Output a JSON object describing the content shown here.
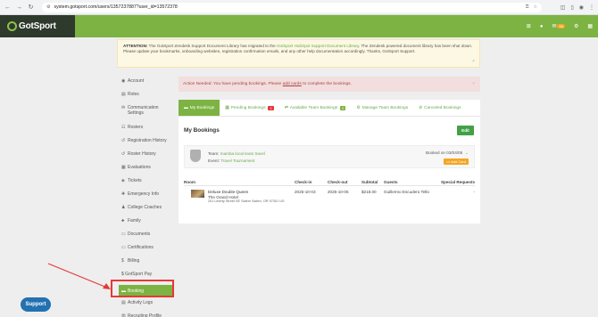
{
  "browser": {
    "url": "system.gotsport.com/users/1357237887?user_id=13572378",
    "back_label": "←",
    "forward_label": "→",
    "reload_label": "↻",
    "icons": [
      "key-icon",
      "star-icon",
      "extensions-icon",
      "profile-icon",
      "menu-icon"
    ]
  },
  "header": {
    "brand": "GotSport",
    "message_count": "99",
    "accent_color": "#7cb342"
  },
  "attention": {
    "label": "ATTENTION:",
    "text_before": " The GotSport Zendesk Support Document Library has migrated to the ",
    "link": "GotSport HubSpot Support Document Library",
    "text_after": ". The Zendesk powered document library has been shut down. Please update your bookmarks, onboarding websites, registration confirmation emails, and any other help documentation accordingly. Thanks, GotSport Support.",
    "close": "×"
  },
  "action_alert": {
    "text_before": "Action Needed: You have pending bookings. Please",
    "link": "add cards",
    "text_after": "to complete the bookings.",
    "close": "×"
  },
  "sidebar": {
    "items": [
      {
        "label": "Account",
        "icon": "user-icon",
        "glyph": "◉"
      },
      {
        "label": "Roles",
        "icon": "id-card-icon",
        "glyph": "▤"
      },
      {
        "label": "Communication Settings",
        "icon": "envelope-icon",
        "glyph": "✉"
      },
      {
        "label": "Rosters",
        "icon": "users-icon",
        "glyph": "☷"
      },
      {
        "label": "Registration History",
        "icon": "history-icon",
        "glyph": "↺"
      },
      {
        "label": "Roster History",
        "icon": "history-icon",
        "glyph": "↺"
      },
      {
        "label": "Evaluations",
        "icon": "clipboard-icon",
        "glyph": "▦"
      },
      {
        "label": "Tickets",
        "icon": "ticket-icon",
        "glyph": "◈"
      },
      {
        "label": "Emergency Info",
        "icon": "medkit-icon",
        "glyph": "✚"
      },
      {
        "label": "College Coaches",
        "icon": "graduation-icon",
        "glyph": "♟"
      },
      {
        "label": "Family",
        "icon": "family-icon",
        "glyph": "♣"
      },
      {
        "label": "Documents",
        "icon": "folder-icon",
        "glyph": "▭"
      },
      {
        "label": "Certifications",
        "icon": "folder-icon",
        "glyph": "▭"
      },
      {
        "label": "Billing",
        "icon": "dollar-icon",
        "glyph": "$"
      },
      {
        "label": "$ GotSport Pay",
        "icon": "",
        "glyph": ""
      },
      {
        "label": "Booking",
        "icon": "bed-icon",
        "glyph": "▬",
        "active": true
      },
      {
        "label": "Activity Logs",
        "icon": "list-icon",
        "glyph": "▤"
      },
      {
        "label": "Recruiting Profile",
        "icon": "chart-icon",
        "glyph": "▥"
      }
    ]
  },
  "tabs": [
    {
      "label": "My Bookings",
      "icon": "bed-icon",
      "glyph": "▬",
      "active": true
    },
    {
      "label": "Pending Bookings",
      "icon": "calendar-icon",
      "glyph": "▦",
      "count": "1"
    },
    {
      "label": "Available Team Bookings",
      "icon": "exchange-icon",
      "glyph": "⇄",
      "count": "0"
    },
    {
      "label": "Manage Team Bookings",
      "icon": "users-cog-icon",
      "glyph": "⚙"
    },
    {
      "label": "Canceled Bookings",
      "icon": "ban-icon",
      "glyph": "⊘"
    }
  ],
  "bookings": {
    "title": "My Bookings",
    "edit_label": "Edit",
    "card": {
      "team_label": "Team:",
      "team": "mamba local team travel",
      "event_label": "Event:",
      "event": "Travel Tournament",
      "booked_on": "Booked on 03/04/05",
      "add_card": "Add Card"
    },
    "columns": [
      "Room",
      "Check-in",
      "Check-out",
      "Subtotal",
      "Guests",
      "Special Requests"
    ],
    "rows": [
      {
        "room": "Deluxe Double Queen",
        "hotel": "The Grand Hotel",
        "address": "201 Liberty Street SE Salem Salem, OR 97301 US",
        "checkin": "2025-10-03",
        "checkout": "2025-10-05",
        "subtotal": "$218.00",
        "guests": "Guillermo Escudero Tello",
        "requests": "-"
      }
    ]
  },
  "support_label": "Support"
}
